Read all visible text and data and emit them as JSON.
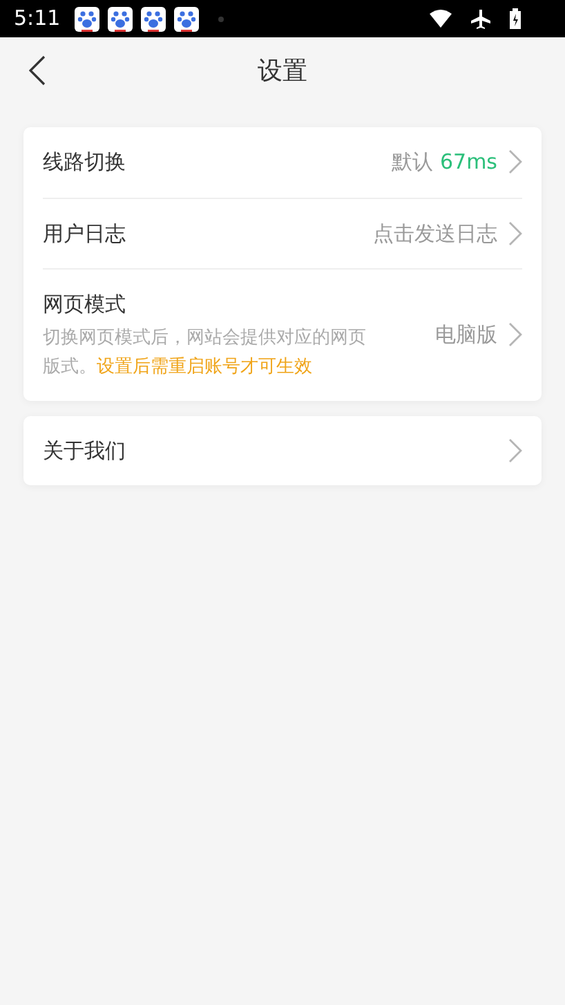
{
  "status_bar": {
    "time": "5:11"
  },
  "header": {
    "title": "设置"
  },
  "groups": [
    {
      "items": [
        {
          "label": "线路切换",
          "value_label": "默认",
          "value": "67ms",
          "kind": "latency"
        },
        {
          "label": "用户日志",
          "value": "点击发送日志",
          "kind": "plain"
        },
        {
          "label": "网页模式",
          "description": "切换网页模式后，网站会提供对应的网页版式。",
          "notice": "设置后需重启账号才可生效",
          "value": "电脑版",
          "kind": "plain"
        }
      ]
    },
    {
      "items": [
        {
          "label": "关于我们"
        }
      ]
    }
  ]
}
